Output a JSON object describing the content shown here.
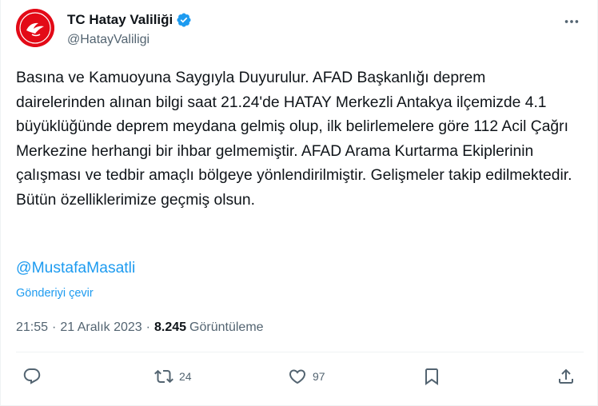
{
  "author": {
    "display_name": "TC Hatay Valiliği",
    "handle": "@HatayValiligi",
    "verified": true,
    "avatar_color": "#e30a17"
  },
  "tweet": {
    "text": "Basına ve Kamuoyuna Saygıyla Duyurulur. AFAD Başkanlığı deprem dairelerinden alınan bilgi saat 21.24'de HATAY Merkezli Antakya ilçemizde 4.1 büyüklüğünde deprem meydana gelmiş olup, ilk belirlemelere göre 112 Acil Çağrı Merkezine herhangi bir ihbar gelmemiştir. AFAD Arama Kurtarma Ekiplerinin çalışması ve tedbir amaçlı bölgeye yönlendirilmiştir. Gelişmeler takip edilmektedir. Bütün özelliklerimize geçmiş olsun.",
    "mention": "@MustafaMasatli",
    "translate_label": "Gönderiyi çevir",
    "time": "21:55",
    "date": "21 Aralık 2023",
    "separator": "·",
    "views_count": "8.245",
    "views_label": "Görüntüleme"
  },
  "actions": {
    "reply_icon": "reply-icon",
    "retweet_count": "24",
    "like_count": "97",
    "bookmark_icon": "bookmark-icon",
    "share_icon": "share-icon"
  },
  "colors": {
    "link": "#1d9bf0",
    "muted": "#536471",
    "text": "#0f1419",
    "verified_badge": "#1d9bf0"
  }
}
